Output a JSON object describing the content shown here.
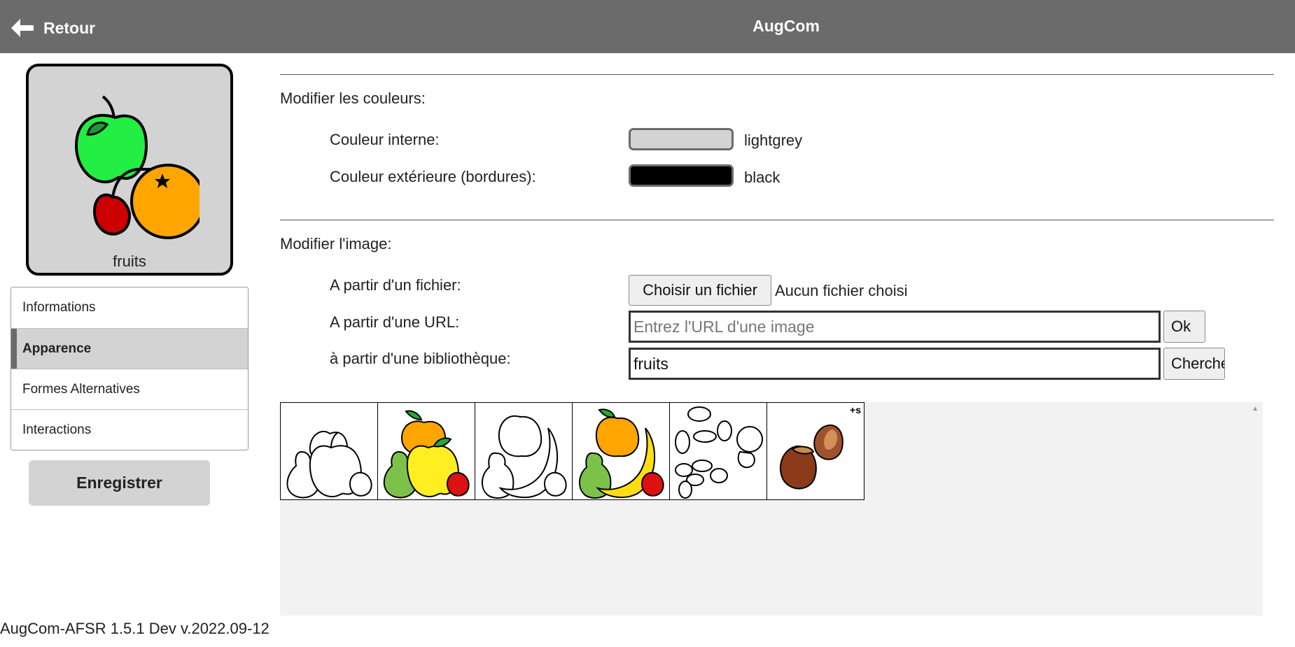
{
  "header": {
    "back_label": "Retour",
    "back_icon": "arrow-left-icon",
    "title": "AugCom"
  },
  "preview": {
    "label": "fruits",
    "background_color": "#d3d3d3",
    "border_color": "#000000",
    "image_icon": "fruits-pictogram"
  },
  "side_menu": {
    "items": [
      {
        "label": "Informations",
        "active": false
      },
      {
        "label": "Apparence",
        "active": true
      },
      {
        "label": "Formes Alternatives",
        "active": false
      },
      {
        "label": "Interactions",
        "active": false
      }
    ]
  },
  "save_label": "Enregistrer",
  "colors": {
    "section_title": "Modifier les couleurs:",
    "inner_label": "Couleur interne:",
    "inner_value": "lightgrey",
    "inner_hex": "#d3d3d3",
    "outer_label": "Couleur extérieure (bordures):",
    "outer_value": "black",
    "outer_hex": "#000000"
  },
  "image": {
    "section_title": "Modifier l'image:",
    "file_label": "A partir d'un fichier:",
    "file_button": "Choisir un fichier",
    "file_status": "Aucun fichier choisi",
    "url_label": "A partir d'une URL:",
    "url_placeholder": "Entrez l'URL d'une image",
    "url_value": "",
    "url_button": "Ok",
    "library_label": "à partir d'une bibliothèque:",
    "library_value": "fruits",
    "library_button": "Chercher"
  },
  "results": [
    {
      "icon": "fruits-outline-icon"
    },
    {
      "icon": "fruits-color-icon"
    },
    {
      "icon": "fruits-banana-outline-icon"
    },
    {
      "icon": "fruits-banana-color-icon"
    },
    {
      "icon": "nuts-outline-icon"
    },
    {
      "icon": "hazelnuts-color-icon",
      "badge": "+s"
    }
  ],
  "footer": "AugCom-AFSR 1.5.1 Dev v.2022.09-12"
}
